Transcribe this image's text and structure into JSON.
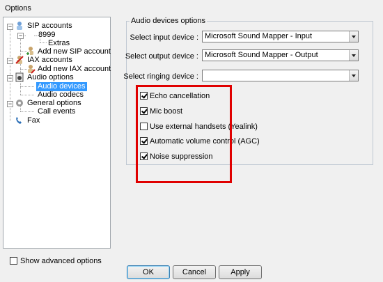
{
  "window": {
    "title": "Options"
  },
  "tree": {
    "items": [
      {
        "label": "SIP accounts"
      },
      {
        "label": "8999"
      },
      {
        "label": "Extras"
      },
      {
        "label": "Add new SIP account"
      },
      {
        "label": "IAX accounts"
      },
      {
        "label": "Add new IAX account"
      },
      {
        "label": "Audio options"
      },
      {
        "label": "Audio devices"
      },
      {
        "label": "Audio codecs"
      },
      {
        "label": "General options"
      },
      {
        "label": "Call events"
      },
      {
        "label": "Fax"
      }
    ]
  },
  "audio_devices": {
    "group_title": "Audio devices options",
    "input_label": "Select input device :",
    "input_value": "Microsoft Sound Mapper - Input",
    "output_label": "Select output device :",
    "output_value": "Microsoft Sound Mapper - Output",
    "ringing_label": "Select ringing device :",
    "ringing_value": "",
    "checks": [
      {
        "label": "Echo cancellation",
        "checked": true
      },
      {
        "label": "Mic boost",
        "checked": true
      },
      {
        "label": "Use external handsets (Yealink)",
        "checked": false
      },
      {
        "label": "Automatic volume control (AGC)",
        "checked": true
      },
      {
        "label": "Noise suppression",
        "checked": true
      }
    ]
  },
  "footer": {
    "advanced_label": "Show advanced options",
    "ok": "OK",
    "cancel": "Cancel",
    "apply": "Apply"
  },
  "colors": {
    "selection": "#3399ff",
    "highlight": "#e00000"
  }
}
